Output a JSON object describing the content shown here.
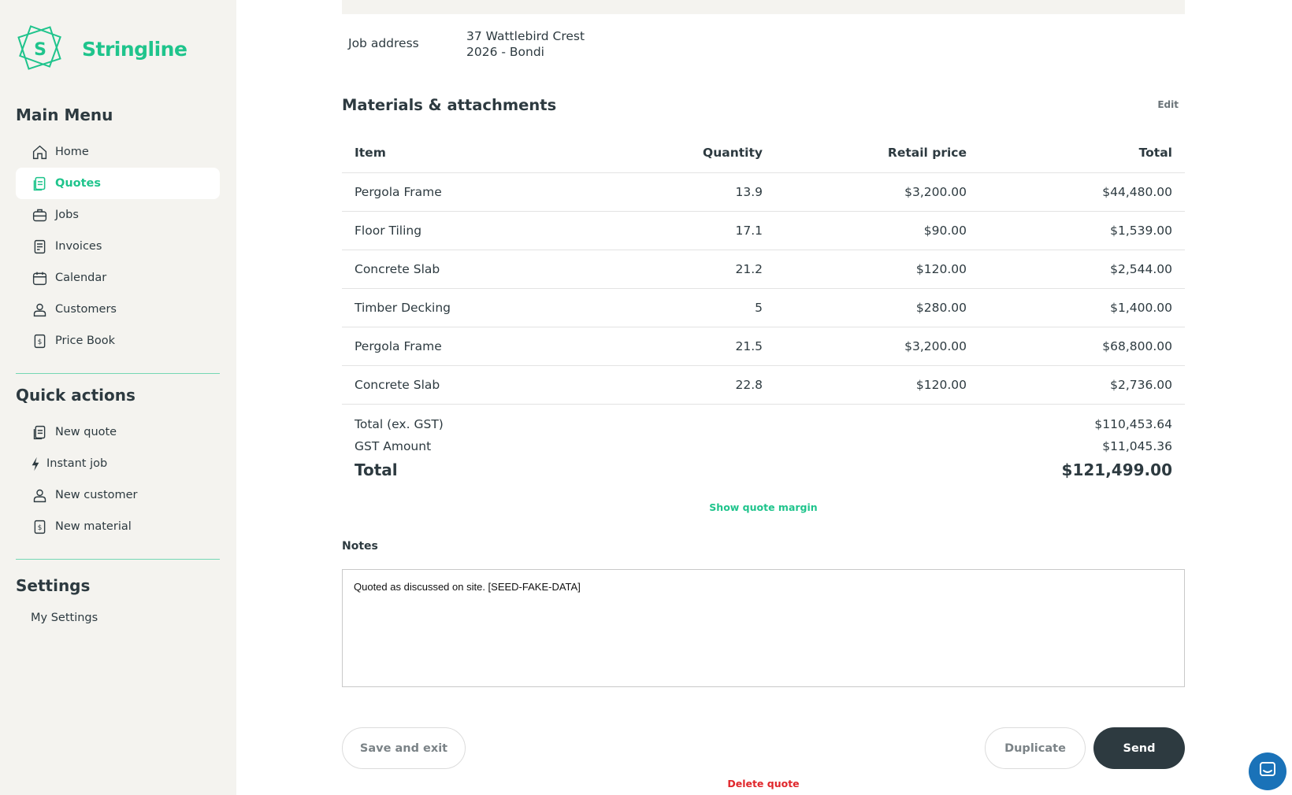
{
  "brand": {
    "name": "Stringline",
    "logo_letter": "S",
    "accent": "#1fc48c"
  },
  "sidebar": {
    "main_menu": {
      "title": "Main Menu",
      "items": [
        {
          "label": "Home",
          "icon": "home-icon"
        },
        {
          "label": "Quotes",
          "icon": "quote-document-icon",
          "active": true
        },
        {
          "label": "Jobs",
          "icon": "briefcase-icon"
        },
        {
          "label": "Invoices",
          "icon": "invoice-icon"
        },
        {
          "label": "Calendar",
          "icon": "calendar-icon"
        },
        {
          "label": "Customers",
          "icon": "user-icon"
        },
        {
          "label": "Price Book",
          "icon": "dollar-tag-icon"
        }
      ]
    },
    "quick_actions": {
      "title": "Quick actions",
      "items": [
        {
          "label": "New quote",
          "icon": "quote-document-icon"
        },
        {
          "label": "Instant job",
          "icon": "lightning-icon"
        },
        {
          "label": "New customer",
          "icon": "user-icon"
        },
        {
          "label": "New material",
          "icon": "dollar-tag-icon"
        }
      ]
    },
    "settings": {
      "title": "Settings",
      "items": [
        {
          "label": "My Settings"
        }
      ]
    }
  },
  "job": {
    "address_label": "Job address",
    "address_line1": "37 Wattlebird Crest",
    "address_line2": "2026 - Bondi"
  },
  "materials": {
    "title": "Materials & attachments",
    "edit_label": "Edit",
    "columns": [
      "Item",
      "Quantity",
      "Retail price",
      "Total"
    ],
    "rows": [
      {
        "item": "Pergola Frame",
        "quantity": "13.9",
        "price": "$3,200.00",
        "total": "$44,480.00"
      },
      {
        "item": "Floor Tiling",
        "quantity": "17.1",
        "price": "$90.00",
        "total": "$1,539.00"
      },
      {
        "item": "Concrete Slab",
        "quantity": "21.2",
        "price": "$120.00",
        "total": "$2,544.00"
      },
      {
        "item": "Timber Decking",
        "quantity": "5",
        "price": "$280.00",
        "total": "$1,400.00"
      },
      {
        "item": "Pergola Frame",
        "quantity": "21.5",
        "price": "$3,200.00",
        "total": "$68,800.00"
      },
      {
        "item": "Concrete Slab",
        "quantity": "22.8",
        "price": "$120.00",
        "total": "$2,736.00"
      }
    ]
  },
  "summary": {
    "subtotal_label": "Total (ex. GST)",
    "subtotal": "$110,453.64",
    "gst_label": "GST Amount",
    "gst": "$11,045.36",
    "total_label": "Total",
    "total": "$121,499.00"
  },
  "margin_link": "Show quote margin",
  "notes": {
    "label": "Notes",
    "value": "Quoted as discussed on site. [SEED-FAKE-DATA]"
  },
  "actions": {
    "save_exit": "Save and exit",
    "duplicate": "Duplicate",
    "send": "Send",
    "delete": "Delete quote"
  },
  "colors": {
    "accent": "#1fc48c",
    "dark": "#2d3a40",
    "danger": "#e0262b",
    "chat": "#1a72b8"
  }
}
